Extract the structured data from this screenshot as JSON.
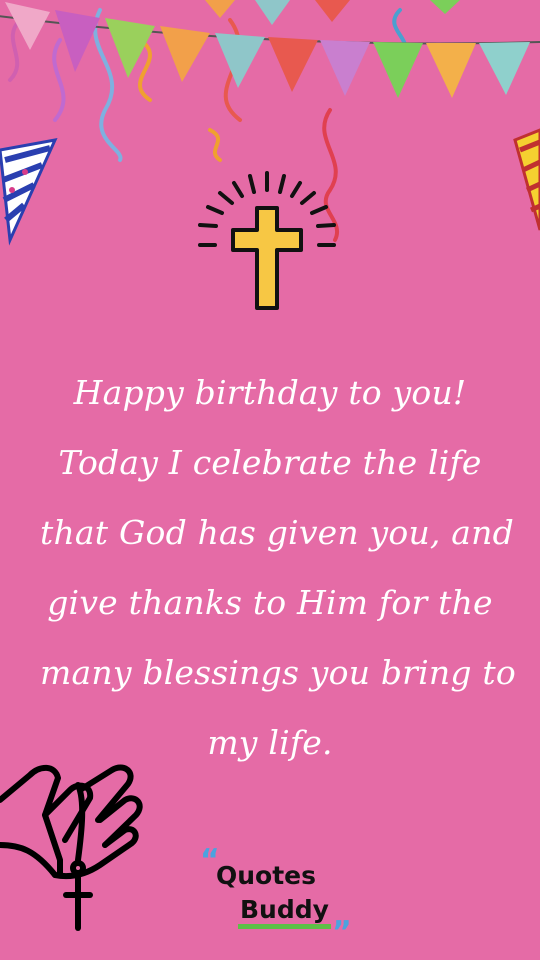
{
  "background_color": "#e56ba6",
  "message": {
    "lines": [
      "Happy birthday to you!",
      "Today I celebrate the life",
      "that God has given you, and",
      "give thanks to Him for the",
      "many blessings you bring to",
      "my life."
    ]
  },
  "logo": {
    "open_quote": "“",
    "word1": "Quotes",
    "word2": "Buddy",
    "close_quote": "”",
    "quote_color": "#4aa3df",
    "underline_color": "#5ec046"
  },
  "decorations": {
    "top": "bunting-flags-icon",
    "left_top": "party-hat-icon",
    "right_top": "party-hat-icon",
    "center": "cross-icon",
    "bottom_left": "praying-hands-rosary-icon",
    "bunting_colors": [
      "#f0a8c8",
      "#9ad05c",
      "#f2a04a",
      "#8fc6c9",
      "#e8594f",
      "#c97fcf",
      "#7bcf5a",
      "#f3b04a",
      "#8fd0cc"
    ]
  }
}
